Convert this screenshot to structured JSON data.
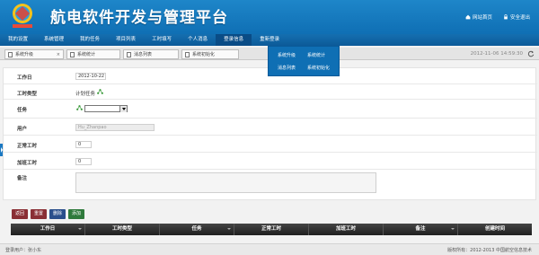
{
  "app": {
    "title": "航电软件开发与管理平台"
  },
  "top_links": {
    "home": "网站首页",
    "logout": "安全退出"
  },
  "mainnav": [
    "我的设置",
    "系统管理",
    "我的任务",
    "项目列表",
    "工时填写",
    "个人消息",
    "登录信息",
    "重新登录"
  ],
  "dropdown": {
    "item1": "系统升级",
    "item2": "系统统计",
    "item3": "消息列表",
    "item4": "系统初始化"
  },
  "tabs": [
    {
      "label": "系统升级"
    },
    {
      "label": "系统统计"
    },
    {
      "label": "消息列表"
    },
    {
      "label": "系统初始化"
    }
  ],
  "clock": "2012-11-06 14:59:30",
  "form": {
    "work_date_label": "工作日",
    "work_date_value": "2012-10-22",
    "type_label": "工时类型",
    "type_value": "计划任务",
    "task_label": "任务",
    "user_label": "用户",
    "user_value": "Hu_Zhanpao",
    "normal_label": "正常工时",
    "normal_value": "0",
    "overtime_label": "加班工时",
    "overtime_value": "0",
    "remark_label": "备注"
  },
  "buttons": {
    "back": "返回",
    "reset": "重置",
    "delete": "删除",
    "add": "添加"
  },
  "grid_columns": [
    "工作日",
    "工时类型",
    "任务",
    "正常工时",
    "加班工时",
    "备注",
    "创建时间"
  ],
  "footer": {
    "user": "登录用户：张小东",
    "copyright": "版权所有：2012-2013 中国航空信息技术"
  },
  "colors": {
    "header": "#1e86c9",
    "nav": "#0c5a98",
    "grid_header": "#2a2a2a"
  }
}
